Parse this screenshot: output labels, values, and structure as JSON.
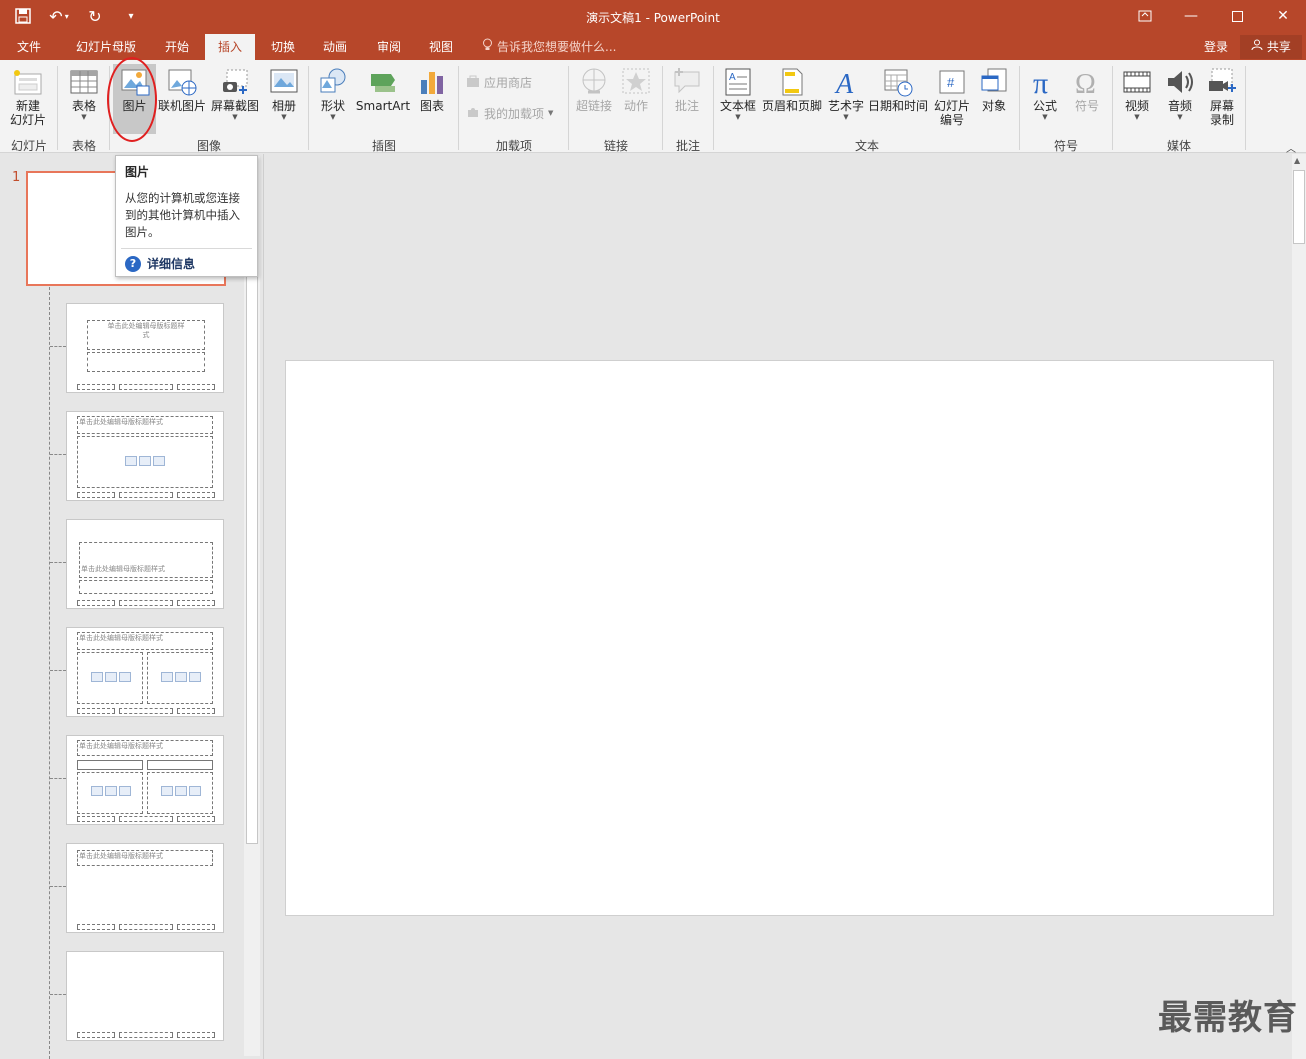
{
  "titlebar": {
    "title": "演示文稿1 - PowerPoint"
  },
  "tabs": [
    {
      "label": "文件"
    },
    {
      "label": "幻灯片母版"
    },
    {
      "label": "开始"
    },
    {
      "label": "插入"
    },
    {
      "label": "切换"
    },
    {
      "label": "动画"
    },
    {
      "label": "审阅"
    },
    {
      "label": "视图"
    }
  ],
  "tellme": "告诉我您想要做什么...",
  "account": {
    "login": "登录",
    "share": "共享"
  },
  "ribbon": {
    "new_slide": "新建\n幻灯片",
    "table": "表格",
    "picture": "图片",
    "online_picture": "联机图片",
    "screenshot": "屏幕截图",
    "album": "相册",
    "shapes": "形状",
    "smartart": "SmartArt",
    "chart": "图表",
    "store": "应用商店",
    "my_addins": "我的加载项",
    "hyperlink": "超链接",
    "action": "动作",
    "comment": "批注",
    "textbox": "文本框",
    "header_footer": "页眉和页脚",
    "wordart": "艺术字",
    "datetime": "日期和时间",
    "slide_number": "幻灯片\n编号",
    "object": "对象",
    "equation": "公式",
    "symbol": "符号",
    "video": "视频",
    "audio": "音频",
    "screen_record": "屏幕\n录制"
  },
  "groups": {
    "slides": "幻灯片",
    "tables": "表格",
    "images": "图像",
    "illustrations": "插图",
    "addins": "加载项",
    "links": "链接",
    "comments": "批注",
    "text": "文本",
    "symbols": "符号",
    "media": "媒体"
  },
  "tooltip": {
    "title": "图片",
    "body": "从您的计算机或您连接到的其他计算机中插入图片。",
    "more": "详细信息"
  },
  "thumbnails": {
    "master_number": "1",
    "title_placeholder": "单击此处编辑母版标题样式",
    "title_placeholder_wrap": "单击此处编辑母版标题样\n式"
  },
  "watermark": "最需教育",
  "colors": {
    "accent": "#b7472a",
    "selected_thumb_border": "#e8765a",
    "highlight_ellipse": "#e02020"
  }
}
